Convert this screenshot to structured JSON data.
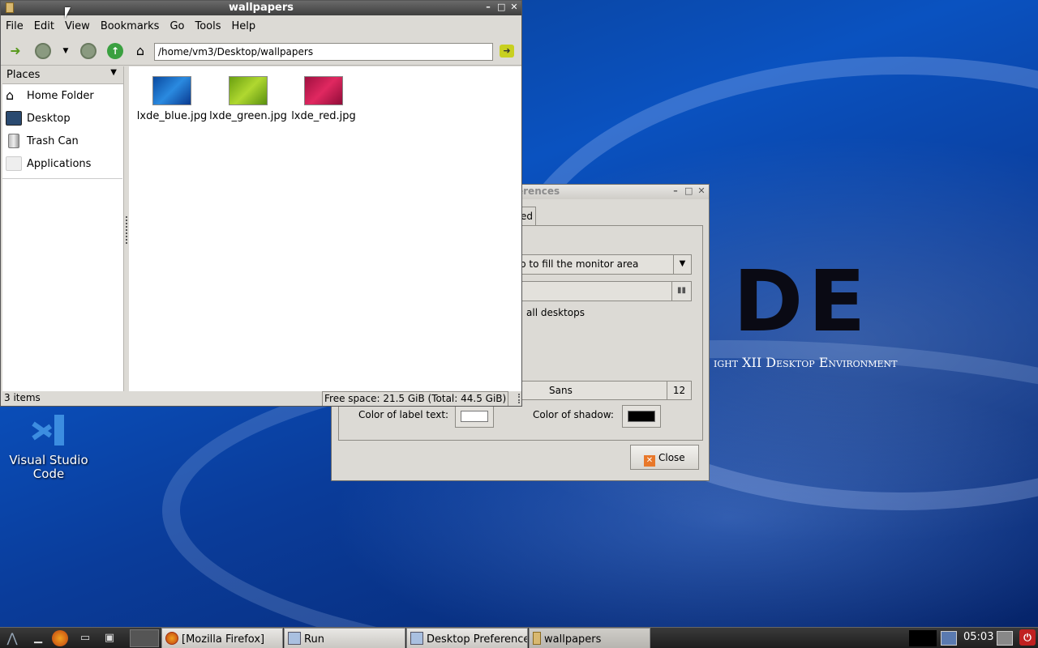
{
  "desktop": {
    "wallpaper_logo": "DE",
    "wallpaper_tagline": "ight XII Desktop Environment",
    "icons": [
      {
        "label": "Visual Studio Code"
      }
    ]
  },
  "prefs_window": {
    "title": "erences",
    "tab_label": "ed",
    "wallpaper_mode": "p to fill the monitor area",
    "wallpaper_file": "",
    "all_desktops_text": "all desktops",
    "font_name": "Sans",
    "font_size": "12",
    "label_text_color_label": "Color of label text:",
    "label_text_color": "#ffffff",
    "shadow_color_label": "Color of shadow:",
    "shadow_color": "#000000",
    "close_label": "Close"
  },
  "file_manager": {
    "title": "wallpapers",
    "menu": [
      "File",
      "Edit",
      "View",
      "Bookmarks",
      "Go",
      "Tools",
      "Help"
    ],
    "path": "/home/vm3/Desktop/wallpapers",
    "places_label": "Places",
    "places": [
      {
        "label": "Home Folder",
        "icon": "home-icon"
      },
      {
        "label": "Desktop",
        "icon": "desktop-icon"
      },
      {
        "label": "Trash Can",
        "icon": "trash-icon"
      },
      {
        "label": "Applications",
        "icon": "applications-icon"
      }
    ],
    "files": [
      {
        "name": "lxde_blue.jpg",
        "color": "#1a6fd0"
      },
      {
        "name": "lxde_green.jpg",
        "color": "#8cc020"
      },
      {
        "name": "lxde_red.jpg",
        "color": "#d01850"
      }
    ],
    "status_items": "3 items",
    "status_space": "Free space: 21.5 GiB (Total: 44.5 GiB)"
  },
  "taskbar": {
    "tasks": [
      {
        "label": "[Mozilla Firefox]"
      },
      {
        "label": "Run"
      },
      {
        "label": "Desktop Preferences"
      },
      {
        "label": "wallpapers"
      }
    ],
    "clock": "05:03"
  }
}
